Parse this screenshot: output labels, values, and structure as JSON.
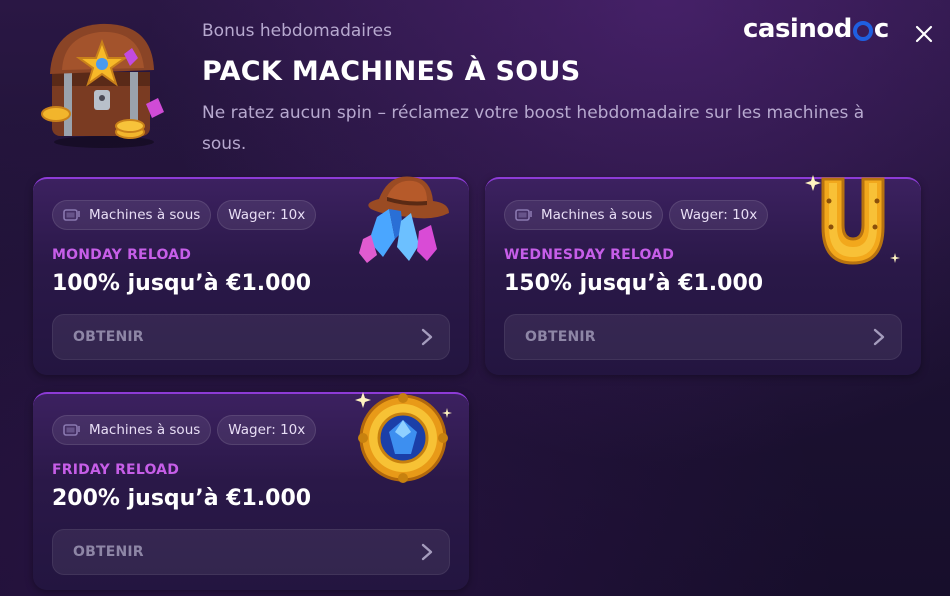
{
  "header": {
    "subtitle": "Bonus hebdomadaires",
    "title": "PACK MACHINES À SOUS",
    "description": "Ne ratez aucun spin – réclamez votre boost hebdomadaire sur les machines à sous.",
    "logo_text_left": "casinod",
    "logo_text_right": "c",
    "chest_icon": "treasure-chest-icon",
    "close_icon": "close-icon"
  },
  "cards": [
    {
      "tag_category": "Machines à sous",
      "tag_wager": "Wager: 10x",
      "label": "MONDAY RELOAD",
      "offer": "100% jusqu’à €1.000",
      "button": "OBTENIR",
      "art_icon": "cowboy-hat-crystals-icon"
    },
    {
      "tag_category": "Machines à sous",
      "tag_wager": "Wager: 10x",
      "label": "WEDNESDAY RELOAD",
      "offer": "150% jusqu’à €1.000",
      "button": "OBTENIR",
      "art_icon": "horseshoe-icon"
    },
    {
      "tag_category": "Machines à sous",
      "tag_wager": "Wager: 10x",
      "label": "FRIDAY RELOAD",
      "offer": "200% jusqu’à €1.000",
      "button": "OBTENIR",
      "art_icon": "sapphire-medallion-icon"
    }
  ],
  "colors": {
    "accent_label": "#c65ee8",
    "card_border": "#8d3bd6",
    "background": "#1d1233",
    "logo_ring": "#1f5fe0"
  }
}
